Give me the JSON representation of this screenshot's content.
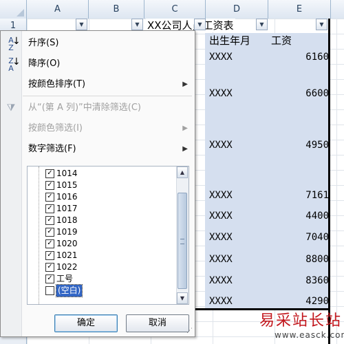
{
  "columns": [
    "A",
    "B",
    "C",
    "D",
    "E"
  ],
  "row_number": "1",
  "cells": {
    "title": "XX公司人员工资表",
    "header_birth": "出生年月",
    "header_salary": "工资"
  },
  "rows": [
    {
      "birth": "XXXX",
      "salary": "6160"
    },
    {
      "birth": "XXXX",
      "salary": "6600"
    },
    {
      "birth": "XXXX",
      "salary": "4950"
    },
    {
      "birth": "XXXX",
      "salary": "7161"
    },
    {
      "birth": "XXXX",
      "salary": "4400"
    },
    {
      "birth": "XXXX",
      "salary": "7040"
    },
    {
      "birth": "XXXX",
      "salary": "8800"
    },
    {
      "birth": "XXXX",
      "salary": "8360"
    },
    {
      "birth": "XXXX",
      "salary": "4290"
    }
  ],
  "menu": {
    "sort_asc": "升序(S)",
    "sort_desc": "降序(O)",
    "sort_by_color": "按颜色排序(T)",
    "clear_filter": "从“(第 A 列)”中清除筛选(C)",
    "filter_by_color": "按颜色筛选(I)",
    "number_filters": "数字筛选(F)"
  },
  "filter_list": [
    {
      "label": "1014",
      "checked": true
    },
    {
      "label": "1015",
      "checked": true
    },
    {
      "label": "1016",
      "checked": true
    },
    {
      "label": "1017",
      "checked": true
    },
    {
      "label": "1018",
      "checked": true
    },
    {
      "label": "1019",
      "checked": true
    },
    {
      "label": "1020",
      "checked": true
    },
    {
      "label": "1021",
      "checked": true
    },
    {
      "label": "1022",
      "checked": true
    },
    {
      "label": "工号",
      "checked": true
    },
    {
      "label": "(空白)",
      "checked": false
    }
  ],
  "buttons": {
    "ok": "确定",
    "cancel": "取消"
  },
  "icons": {
    "sort_asc": "sort-ascending-icon",
    "sort_desc": "sort-descending-icon",
    "clear_filter": "clear-filter-icon"
  },
  "watermark": {
    "cn": "易采站长站",
    "url": "www.easck.com"
  },
  "colors": {
    "header_bg": "#dde6f1",
    "grid_line": "#dfe4ea",
    "shade": "#d5dfef",
    "watermark": "#c2161c",
    "selection": "#3165c5"
  }
}
